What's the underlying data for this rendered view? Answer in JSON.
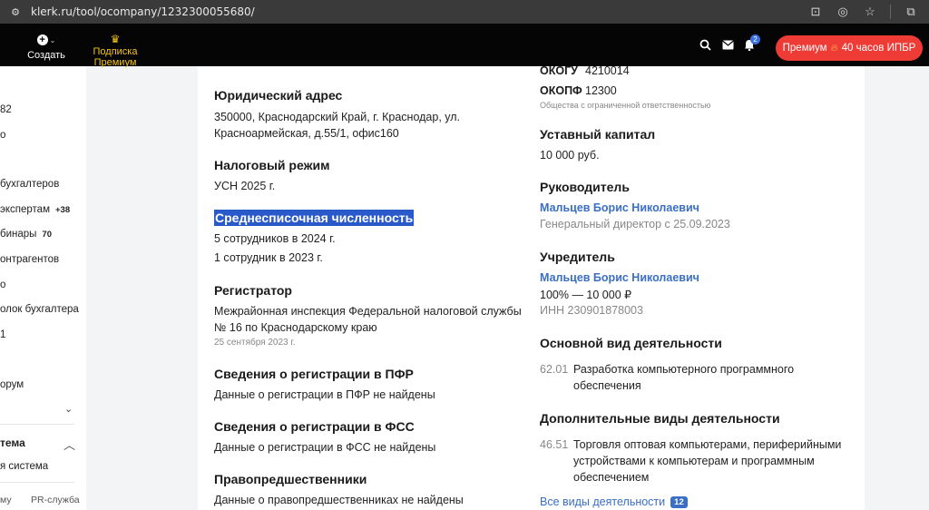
{
  "browser": {
    "url": "klerk.ru/tool/ocompany/1232300055680/",
    "icons": [
      "site-info-icon",
      "install-icon",
      "eye-off-icon",
      "star-icon",
      "extensions-icon"
    ]
  },
  "header": {
    "create_label": "Создать",
    "subscription_label": "Подписка Премиум",
    "notifications_count": "2",
    "premium_button": "Премиум",
    "premium_promo": "40 часов ИПБР",
    "accent_color": "#ef3b36"
  },
  "sidebar": {
    "items": [
      {
        "label": "82"
      },
      {
        "label": "о"
      },
      {
        "label": "бухгалтеров"
      },
      {
        "label": "экспертам",
        "badge": "+38"
      },
      {
        "label": "бинары",
        "badge": "70"
      },
      {
        "label": "онтрагентов"
      },
      {
        "label": "о"
      },
      {
        "label": "олок бухгалтера"
      },
      {
        "label": "1"
      },
      {
        "label": "орум"
      },
      {
        "label": "тема"
      },
      {
        "label": "я система"
      },
      {
        "label": "му"
      },
      {
        "label": "PR-служба"
      }
    ]
  },
  "company": {
    "legal_address": {
      "title": "Юридический адрес",
      "line1": "350000, Краснодарский Край, г. Краснодар, ул.",
      "line2": "Красноармейская, д.55/1, офис160"
    },
    "tax_regime": {
      "title": "Налоговый режим",
      "value": "УСН 2025 г."
    },
    "headcount": {
      "title": "Среднесписочная численность",
      "line1": "5 сотрудников в 2024 г.",
      "line2": "1 сотрудник в 2023 г."
    },
    "registrar": {
      "title": "Регистратор",
      "line1": "Межрайонная инспекция Федеральной налоговой службы",
      "line2": "№ 16 по Краснодарскому краю",
      "date": "25 сентября 2023 г."
    },
    "pfr": {
      "title": "Сведения о регистрации в ПФР",
      "value": "Данные о регистрации в ПФР не найдены"
    },
    "fss": {
      "title": "Сведения о регистрации в ФСС",
      "value": "Данные о регистрации в ФСС не найдены"
    },
    "predecessors": {
      "title": "Правопредшественники",
      "value": "Данные о правопредшественниках не найдены"
    },
    "okogu": {
      "label": "ОКОГУ",
      "value": "4210014"
    },
    "okopf": {
      "label": "ОКОПФ",
      "value": "12300",
      "desc": "Общества с ограниченной ответственностью"
    },
    "capital": {
      "title": "Уставный капитал",
      "value": "10 000 руб."
    },
    "director": {
      "title": "Руководитель",
      "name": "Мальцев Борис Николаевич",
      "position": "Генеральный директор с 25.09.2023"
    },
    "founder": {
      "title": "Учредитель",
      "name": "Мальцев Борис Николаевич",
      "share": "100% — 10 000 ₽",
      "inn": "ИНН 230901878003"
    },
    "main_activity": {
      "title": "Основной вид деятельности",
      "code": "62.01",
      "line1": "Разработка компьютерного программного",
      "line2": "обеспечения"
    },
    "extra_activities": {
      "title": "Дополнительные виды деятельности",
      "code": "46.51",
      "line1": "Торговля оптовая компьютерами, периферийными",
      "line2": "устройствами к компьютерам и программным",
      "line3": "обеспечением",
      "all_link": "Все виды деятельности",
      "all_count": "12"
    }
  }
}
